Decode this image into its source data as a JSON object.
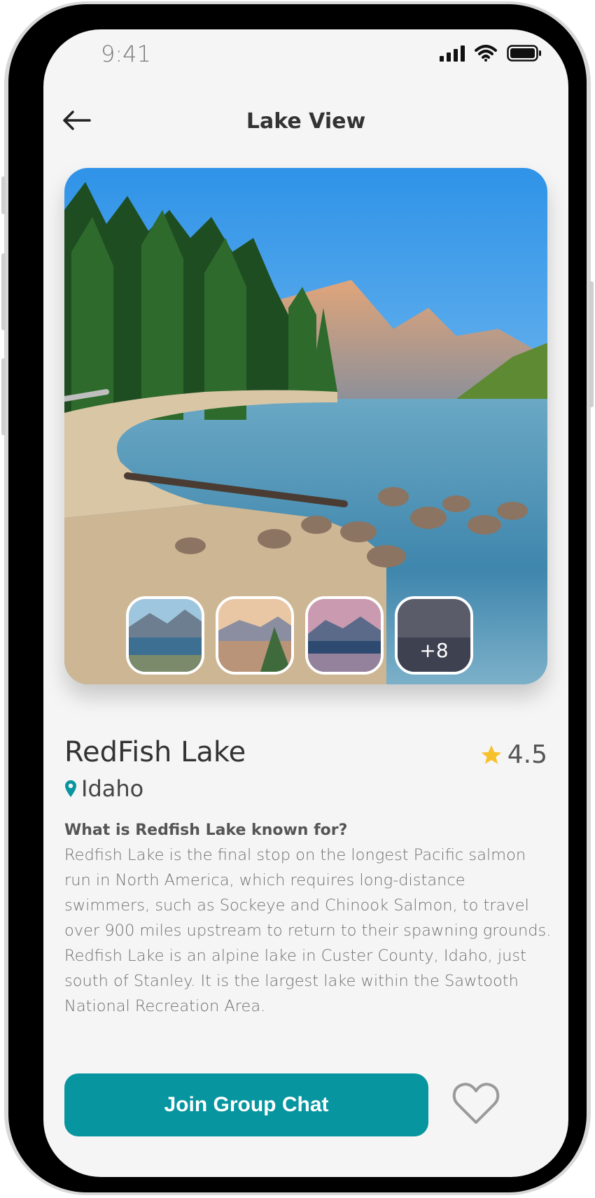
{
  "status_bar": {
    "time": "9:41"
  },
  "header": {
    "title": "Lake View",
    "back_icon": "arrow-left-icon"
  },
  "hero": {
    "alt": "RedFish Lake mountain landscape",
    "thumbnails": [
      {
        "name": "thumbnail-1"
      },
      {
        "name": "thumbnail-2"
      },
      {
        "name": "thumbnail-3"
      },
      {
        "name": "thumbnail-more",
        "label": "+8"
      }
    ]
  },
  "place": {
    "name": "RedFish Lake",
    "rating": "4.5",
    "location": "Idaho",
    "accent_color": "#0795a0",
    "star_color": "#f7c12b"
  },
  "about": {
    "question": "What is Redfish Lake known for?",
    "description": "Redfish Lake is the final stop on the longest Pacific salmon run in North America, which requires long-distance swimmers, such as Sockeye and Chinook Salmon, to travel over 900 miles upstream to return to their spawning grounds. Redfish Lake is an alpine lake in Custer County, Idaho, just south of Stanley. It is the largest lake within the Sawtooth National Recreation Area."
  },
  "actions": {
    "join_label": "Join Group Chat",
    "favorite_icon": "heart-icon"
  }
}
